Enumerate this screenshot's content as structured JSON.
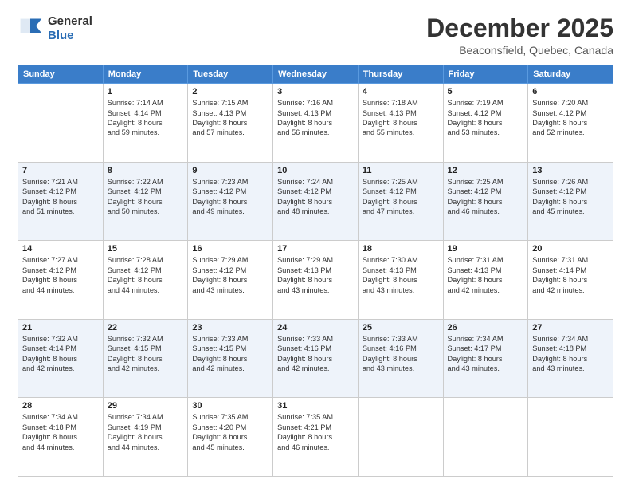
{
  "header": {
    "logo_line1": "General",
    "logo_line2": "Blue",
    "month": "December 2025",
    "location": "Beaconsfield, Quebec, Canada"
  },
  "weekdays": [
    "Sunday",
    "Monday",
    "Tuesday",
    "Wednesday",
    "Thursday",
    "Friday",
    "Saturday"
  ],
  "weeks": [
    [
      {
        "day": "",
        "info": ""
      },
      {
        "day": "1",
        "info": "Sunrise: 7:14 AM\nSunset: 4:14 PM\nDaylight: 8 hours\nand 59 minutes."
      },
      {
        "day": "2",
        "info": "Sunrise: 7:15 AM\nSunset: 4:13 PM\nDaylight: 8 hours\nand 57 minutes."
      },
      {
        "day": "3",
        "info": "Sunrise: 7:16 AM\nSunset: 4:13 PM\nDaylight: 8 hours\nand 56 minutes."
      },
      {
        "day": "4",
        "info": "Sunrise: 7:18 AM\nSunset: 4:13 PM\nDaylight: 8 hours\nand 55 minutes."
      },
      {
        "day": "5",
        "info": "Sunrise: 7:19 AM\nSunset: 4:12 PM\nDaylight: 8 hours\nand 53 minutes."
      },
      {
        "day": "6",
        "info": "Sunrise: 7:20 AM\nSunset: 4:12 PM\nDaylight: 8 hours\nand 52 minutes."
      }
    ],
    [
      {
        "day": "7",
        "info": "Sunrise: 7:21 AM\nSunset: 4:12 PM\nDaylight: 8 hours\nand 51 minutes."
      },
      {
        "day": "8",
        "info": "Sunrise: 7:22 AM\nSunset: 4:12 PM\nDaylight: 8 hours\nand 50 minutes."
      },
      {
        "day": "9",
        "info": "Sunrise: 7:23 AM\nSunset: 4:12 PM\nDaylight: 8 hours\nand 49 minutes."
      },
      {
        "day": "10",
        "info": "Sunrise: 7:24 AM\nSunset: 4:12 PM\nDaylight: 8 hours\nand 48 minutes."
      },
      {
        "day": "11",
        "info": "Sunrise: 7:25 AM\nSunset: 4:12 PM\nDaylight: 8 hours\nand 47 minutes."
      },
      {
        "day": "12",
        "info": "Sunrise: 7:25 AM\nSunset: 4:12 PM\nDaylight: 8 hours\nand 46 minutes."
      },
      {
        "day": "13",
        "info": "Sunrise: 7:26 AM\nSunset: 4:12 PM\nDaylight: 8 hours\nand 45 minutes."
      }
    ],
    [
      {
        "day": "14",
        "info": "Sunrise: 7:27 AM\nSunset: 4:12 PM\nDaylight: 8 hours\nand 44 minutes."
      },
      {
        "day": "15",
        "info": "Sunrise: 7:28 AM\nSunset: 4:12 PM\nDaylight: 8 hours\nand 44 minutes."
      },
      {
        "day": "16",
        "info": "Sunrise: 7:29 AM\nSunset: 4:12 PM\nDaylight: 8 hours\nand 43 minutes."
      },
      {
        "day": "17",
        "info": "Sunrise: 7:29 AM\nSunset: 4:13 PM\nDaylight: 8 hours\nand 43 minutes."
      },
      {
        "day": "18",
        "info": "Sunrise: 7:30 AM\nSunset: 4:13 PM\nDaylight: 8 hours\nand 43 minutes."
      },
      {
        "day": "19",
        "info": "Sunrise: 7:31 AM\nSunset: 4:13 PM\nDaylight: 8 hours\nand 42 minutes."
      },
      {
        "day": "20",
        "info": "Sunrise: 7:31 AM\nSunset: 4:14 PM\nDaylight: 8 hours\nand 42 minutes."
      }
    ],
    [
      {
        "day": "21",
        "info": "Sunrise: 7:32 AM\nSunset: 4:14 PM\nDaylight: 8 hours\nand 42 minutes."
      },
      {
        "day": "22",
        "info": "Sunrise: 7:32 AM\nSunset: 4:15 PM\nDaylight: 8 hours\nand 42 minutes."
      },
      {
        "day": "23",
        "info": "Sunrise: 7:33 AM\nSunset: 4:15 PM\nDaylight: 8 hours\nand 42 minutes."
      },
      {
        "day": "24",
        "info": "Sunrise: 7:33 AM\nSunset: 4:16 PM\nDaylight: 8 hours\nand 42 minutes."
      },
      {
        "day": "25",
        "info": "Sunrise: 7:33 AM\nSunset: 4:16 PM\nDaylight: 8 hours\nand 43 minutes."
      },
      {
        "day": "26",
        "info": "Sunrise: 7:34 AM\nSunset: 4:17 PM\nDaylight: 8 hours\nand 43 minutes."
      },
      {
        "day": "27",
        "info": "Sunrise: 7:34 AM\nSunset: 4:18 PM\nDaylight: 8 hours\nand 43 minutes."
      }
    ],
    [
      {
        "day": "28",
        "info": "Sunrise: 7:34 AM\nSunset: 4:18 PM\nDaylight: 8 hours\nand 44 minutes."
      },
      {
        "day": "29",
        "info": "Sunrise: 7:34 AM\nSunset: 4:19 PM\nDaylight: 8 hours\nand 44 minutes."
      },
      {
        "day": "30",
        "info": "Sunrise: 7:35 AM\nSunset: 4:20 PM\nDaylight: 8 hours\nand 45 minutes."
      },
      {
        "day": "31",
        "info": "Sunrise: 7:35 AM\nSunset: 4:21 PM\nDaylight: 8 hours\nand 46 minutes."
      },
      {
        "day": "",
        "info": ""
      },
      {
        "day": "",
        "info": ""
      },
      {
        "day": "",
        "info": ""
      }
    ]
  ]
}
